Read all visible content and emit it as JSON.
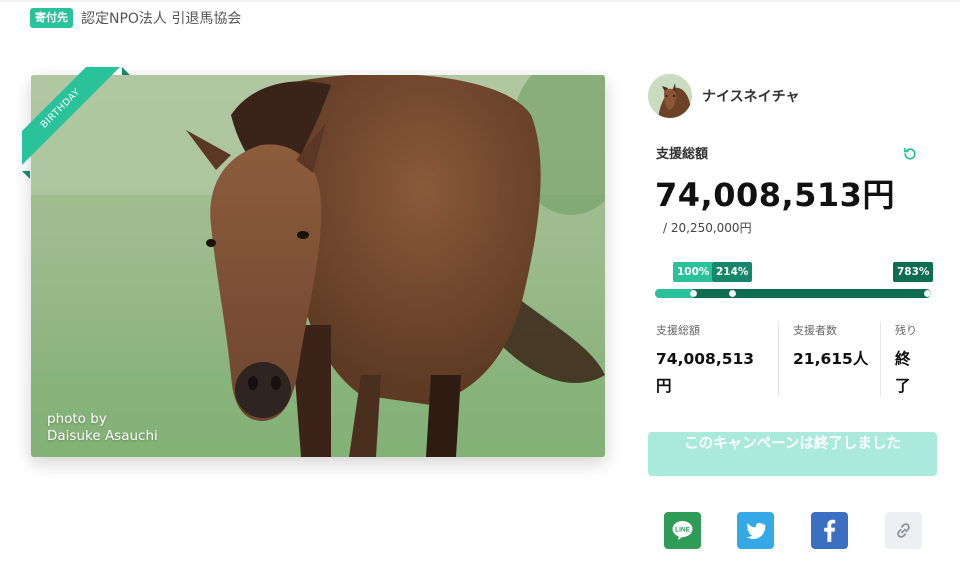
{
  "recipient": {
    "badge": "寄付先",
    "name": "認定NPO法人 引退馬協会"
  },
  "photo": {
    "ribbon": "BIRTHDAY",
    "credit_line1": "photo by",
    "credit_line2": "Daisuke Asauchi"
  },
  "profile": {
    "name": "ナイスネイチャ"
  },
  "total": {
    "label": "支援総額",
    "amount": "74,008,513円",
    "goal": "/ 20,250,000円"
  },
  "progress": {
    "percent_of_goal": 783,
    "milestones": [
      {
        "label": "100%",
        "value": 100,
        "color": "#2ac29a"
      },
      {
        "label": "214%",
        "value": 214,
        "color": "#17876a"
      },
      {
        "label": "783%",
        "value": 783,
        "color": "#0f6d4f"
      }
    ],
    "fill_color": "#2ac29a",
    "track_color": "#0f6d4f"
  },
  "stats": {
    "total": {
      "label": "支援総額",
      "value": "74,008,513円"
    },
    "supporters": {
      "label": "支援者数",
      "value": "21,615人"
    },
    "remaining": {
      "label": "残り",
      "value": "終了"
    }
  },
  "status_button": {
    "label": "このキャンペーンは終了しました"
  },
  "share": [
    {
      "name": "line-share-button",
      "icon": "line-icon",
      "color": "#2e9c57"
    },
    {
      "name": "twitter-share-button",
      "icon": "twitter-icon",
      "color": "#35a9e5"
    },
    {
      "name": "facebook-share-button",
      "icon": "facebook-icon",
      "color": "#3b6fc2"
    },
    {
      "name": "copy-link-button",
      "icon": "link-icon",
      "color": "#edf0f3"
    }
  ],
  "colors": {
    "accent": "#2ac29a",
    "accent_dark": "#0f6d4f",
    "button_disabled": "#a9eadb"
  }
}
